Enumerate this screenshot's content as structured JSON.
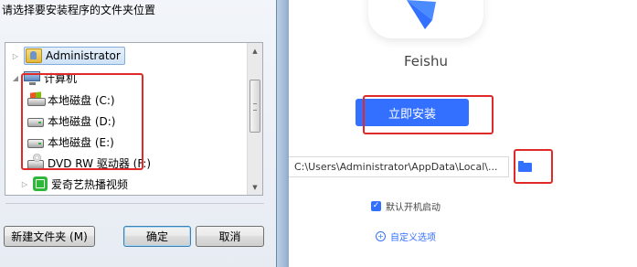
{
  "dialog": {
    "prompt": "请选择要安装程序的文件夹位置",
    "tree": [
      {
        "label": "Administrator",
        "icon": "user-folder-icon",
        "selected": true
      },
      {
        "label": "计算机",
        "icon": "computer-icon",
        "expanded": true
      },
      {
        "label": "本地磁盘 (C:)",
        "icon": "windows-drive-icon"
      },
      {
        "label": "本地磁盘 (D:)",
        "icon": "drive-icon"
      },
      {
        "label": "本地磁盘 (E:)",
        "icon": "drive-icon"
      },
      {
        "label": "DVD RW 驱动器 (F:)",
        "icon": "dvd-drive-icon"
      },
      {
        "label": "爱奇艺热播视频",
        "icon": "iqiyi-icon"
      }
    ],
    "buttons": {
      "new_folder": "新建文件夹 (M)",
      "ok": "确定",
      "cancel": "取消"
    }
  },
  "installer": {
    "app_name": "Feishu",
    "install_button": "立即安装",
    "install_path": "C:\\Users\\Administrator\\AppData\\Local\\...",
    "autostart_label": "默认开机启动",
    "autostart_checked": true,
    "custom_options": "自定义选项",
    "accent_color": "#3370ff"
  },
  "annotation_color": "#e02a2a"
}
